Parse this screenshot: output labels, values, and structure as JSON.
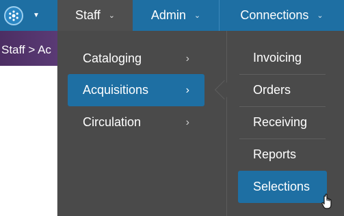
{
  "nav": {
    "home": {
      "icon": "library-logo-icon",
      "caret_icon": "caret-down-icon"
    },
    "items": [
      {
        "label": "Staff",
        "icon": "chevron-down-icon"
      },
      {
        "label": "Admin",
        "icon": "chevron-down-icon"
      },
      {
        "label": "Connections",
        "icon": "chevron-down-icon"
      }
    ]
  },
  "breadcrumb": {
    "text": "Staff > Ac"
  },
  "menu": {
    "items": [
      {
        "label": "Cataloging",
        "icon": "chevron-right-icon"
      },
      {
        "label": "Acquisitions",
        "icon": "chevron-right-icon"
      },
      {
        "label": "Circulation",
        "icon": "chevron-right-icon"
      }
    ],
    "submenu": [
      {
        "label": "Invoicing"
      },
      {
        "label": "Orders"
      },
      {
        "label": "Receiving"
      },
      {
        "label": "Reports"
      },
      {
        "label": "Selections"
      }
    ]
  },
  "colors": {
    "navbar": "#1e6fa3",
    "menu_bg": "#4a4a4a",
    "selected": "#1e6fa3",
    "crumb_bg": "#4c2e63"
  }
}
